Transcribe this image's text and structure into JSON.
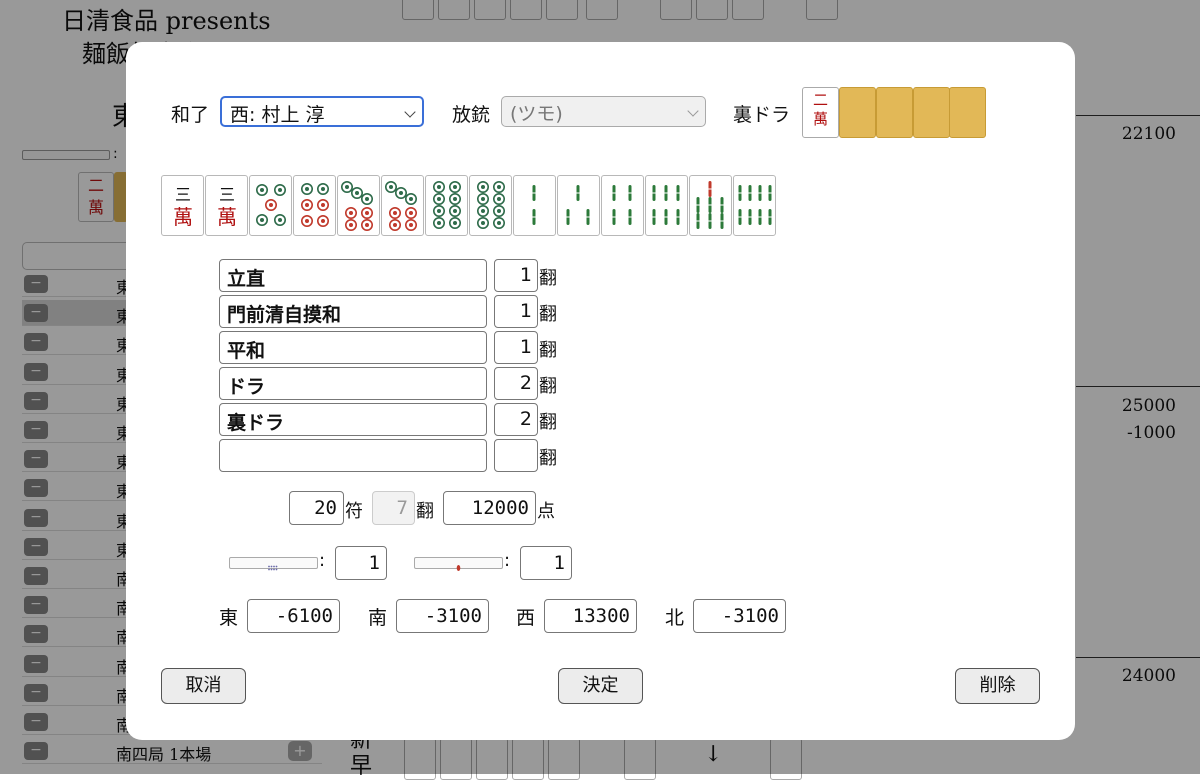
{
  "background": {
    "title_line1": "日清食品 presents",
    "title_line2": "麺飯杯大会",
    "seat_east": "東",
    "dora_tile": "二萬",
    "rounds": [
      {
        "label": "東"
      },
      {
        "label": "東"
      },
      {
        "label": "東"
      },
      {
        "label": "東"
      },
      {
        "label": "東"
      },
      {
        "label": "東"
      },
      {
        "label": "東"
      },
      {
        "label": "東"
      },
      {
        "label": "東"
      },
      {
        "label": "東"
      },
      {
        "label": "南"
      },
      {
        "label": "南"
      },
      {
        "label": "南"
      },
      {
        "label": "南"
      },
      {
        "label": "南"
      },
      {
        "label": "南"
      },
      {
        "label": "南四局 1本場"
      }
    ],
    "scores": [
      "22100",
      "25000",
      "-1000",
      "24000"
    ],
    "bottom_chars": [
      "新",
      "早"
    ],
    "bottom_arrow": "↓"
  },
  "dialog": {
    "win_label": "和了",
    "winner_select": "西: 村上 淳",
    "deal_in_label": "放銃",
    "deal_in_select": "(ツモ)",
    "ura_label": "裏ドラ",
    "ura_tile": "二萬",
    "hand_tiles": [
      {
        "name": "3-man",
        "suit": "man",
        "rank": 3
      },
      {
        "name": "3-man",
        "suit": "man",
        "rank": 3
      },
      {
        "name": "5-pin",
        "suit": "pin",
        "rank": 5
      },
      {
        "name": "6-pin",
        "suit": "pin",
        "rank": 6
      },
      {
        "name": "7-pin",
        "suit": "pin",
        "rank": 7
      },
      {
        "name": "7-pin",
        "suit": "pin",
        "rank": 7
      },
      {
        "name": "8-pin",
        "suit": "pin",
        "rank": 8
      },
      {
        "name": "8-pin",
        "suit": "pin",
        "rank": 8
      },
      {
        "name": "2-sou",
        "suit": "sou",
        "rank": 2
      },
      {
        "name": "3-sou",
        "suit": "sou",
        "rank": 3
      },
      {
        "name": "4-sou",
        "suit": "sou",
        "rank": 4
      },
      {
        "name": "6-sou",
        "suit": "sou",
        "rank": 6
      },
      {
        "name": "7-sou",
        "suit": "sou",
        "rank": 7
      },
      {
        "name": "8-sou",
        "suit": "sou",
        "rank": 8
      }
    ],
    "yaku": [
      {
        "name": "立直",
        "han": "1"
      },
      {
        "name": "門前清自摸和",
        "han": "1"
      },
      {
        "name": "平和",
        "han": "1"
      },
      {
        "name": "ドラ",
        "han": "2"
      },
      {
        "name": "裏ドラ",
        "han": "2"
      },
      {
        "name": "",
        "han": ""
      }
    ],
    "han_unit": "翻",
    "fu": "20",
    "fu_unit": "符",
    "total_han": "7",
    "points": "12000",
    "points_unit": "点",
    "honba": "1",
    "riichi_sticks": "1",
    "colon": ":",
    "seats": [
      {
        "wind": "東",
        "delta": "-6100"
      },
      {
        "wind": "南",
        "delta": "-3100"
      },
      {
        "wind": "西",
        "delta": "13300"
      },
      {
        "wind": "北",
        "delta": "-3100"
      }
    ],
    "cancel_label": "取消",
    "ok_label": "決定",
    "delete_label": "削除"
  },
  "colors": {
    "overlay": "#000000",
    "tile_back": "#e2b857",
    "man_red": "#b01010",
    "pin_red": "#c0392b",
    "pin_green": "#2e6b4a",
    "sou_green": "#2c7a3a",
    "focus_blue": "#3a6fd8"
  }
}
